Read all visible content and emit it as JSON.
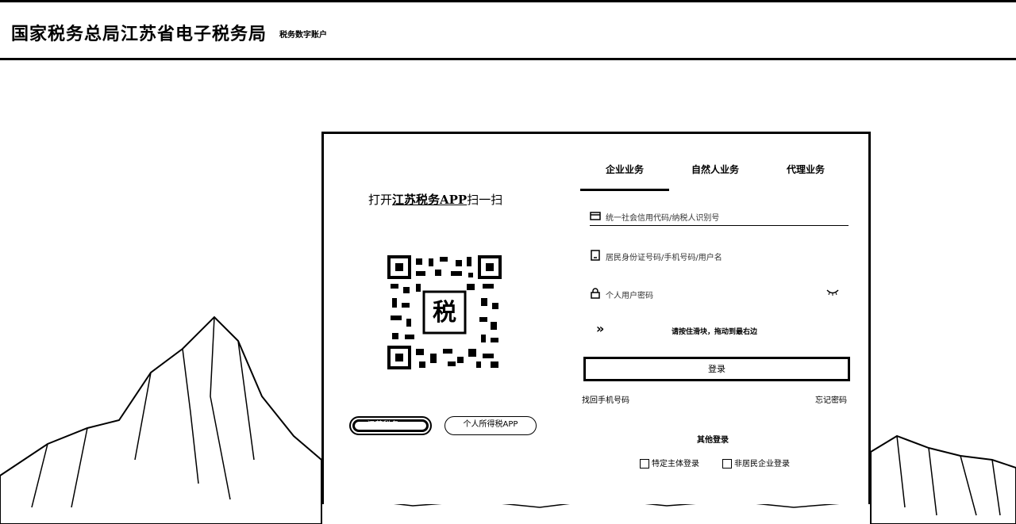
{
  "header": {
    "title": "国家税务总局江苏省电子税务局",
    "subtitle": "税务数字账户"
  },
  "scan": {
    "prefix": "打开",
    "app_name": "江苏税务APP",
    "suffix": "扫一扫"
  },
  "app_buttons": [
    {
      "label": "江苏税务APP"
    },
    {
      "label": "个人所得税APP"
    }
  ],
  "tabs": [
    {
      "label": "企业业务",
      "active": true
    },
    {
      "label": "自然人业务",
      "active": false
    },
    {
      "label": "代理业务",
      "active": false
    }
  ],
  "form": {
    "credit_code_placeholder": "统一社会信用代码/纳税人识别号",
    "account_placeholder": "居民身份证号码/手机号码/用户名",
    "password_placeholder": "个人用户密码",
    "slider_text": "请按住滑块，拖动到最右边",
    "login_label": "登录",
    "find_phone": "找回手机号码",
    "forgot_password": "忘记密码"
  },
  "other_login": {
    "title": "其他登录",
    "options": [
      {
        "label": "特定主体登录",
        "icon": "camera-icon"
      },
      {
        "label": "非居民企业登录",
        "icon": "login-icon"
      }
    ]
  }
}
